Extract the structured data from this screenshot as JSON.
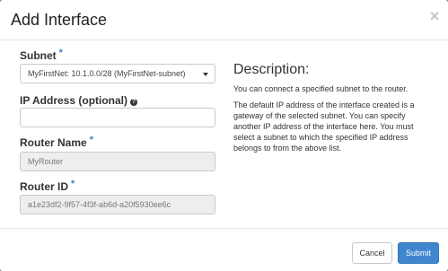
{
  "dialog": {
    "title": "Add Interface",
    "close_glyph": "×"
  },
  "form": {
    "subnet": {
      "label": "Subnet",
      "required_mark": "*",
      "selected": "MyFirstNet: 10.1.0.0/28 (MyFirstNet-subnet)"
    },
    "ip_address": {
      "label": "IP Address (optional)",
      "help_glyph": "?",
      "value": ""
    },
    "router_name": {
      "label": "Router Name",
      "required_mark": "*",
      "value": "MyRouter"
    },
    "router_id": {
      "label": "Router ID",
      "required_mark": "*",
      "value": "a1e23df2-9f57-4f3f-ab6d-a20f5930ee6c"
    }
  },
  "description": {
    "heading": "Description:",
    "paragraph1": "You can connect a specified subnet to the router.",
    "paragraph2": "The default IP address of the interface created is a gateway of the selected subnet. You can specify another IP address of the interface here. You must select a subnet to which the specified IP address belongs to from the above list."
  },
  "footer": {
    "cancel_label": "Cancel",
    "submit_label": "Submit"
  },
  "colors": {
    "required_mark": "#3c82c8",
    "submit_button": "#3f86cf",
    "readonly_field": "#eeeeee"
  },
  "icons": {
    "close": "close-icon",
    "help": "help-icon",
    "dropdown": "chevron-down-icon"
  }
}
